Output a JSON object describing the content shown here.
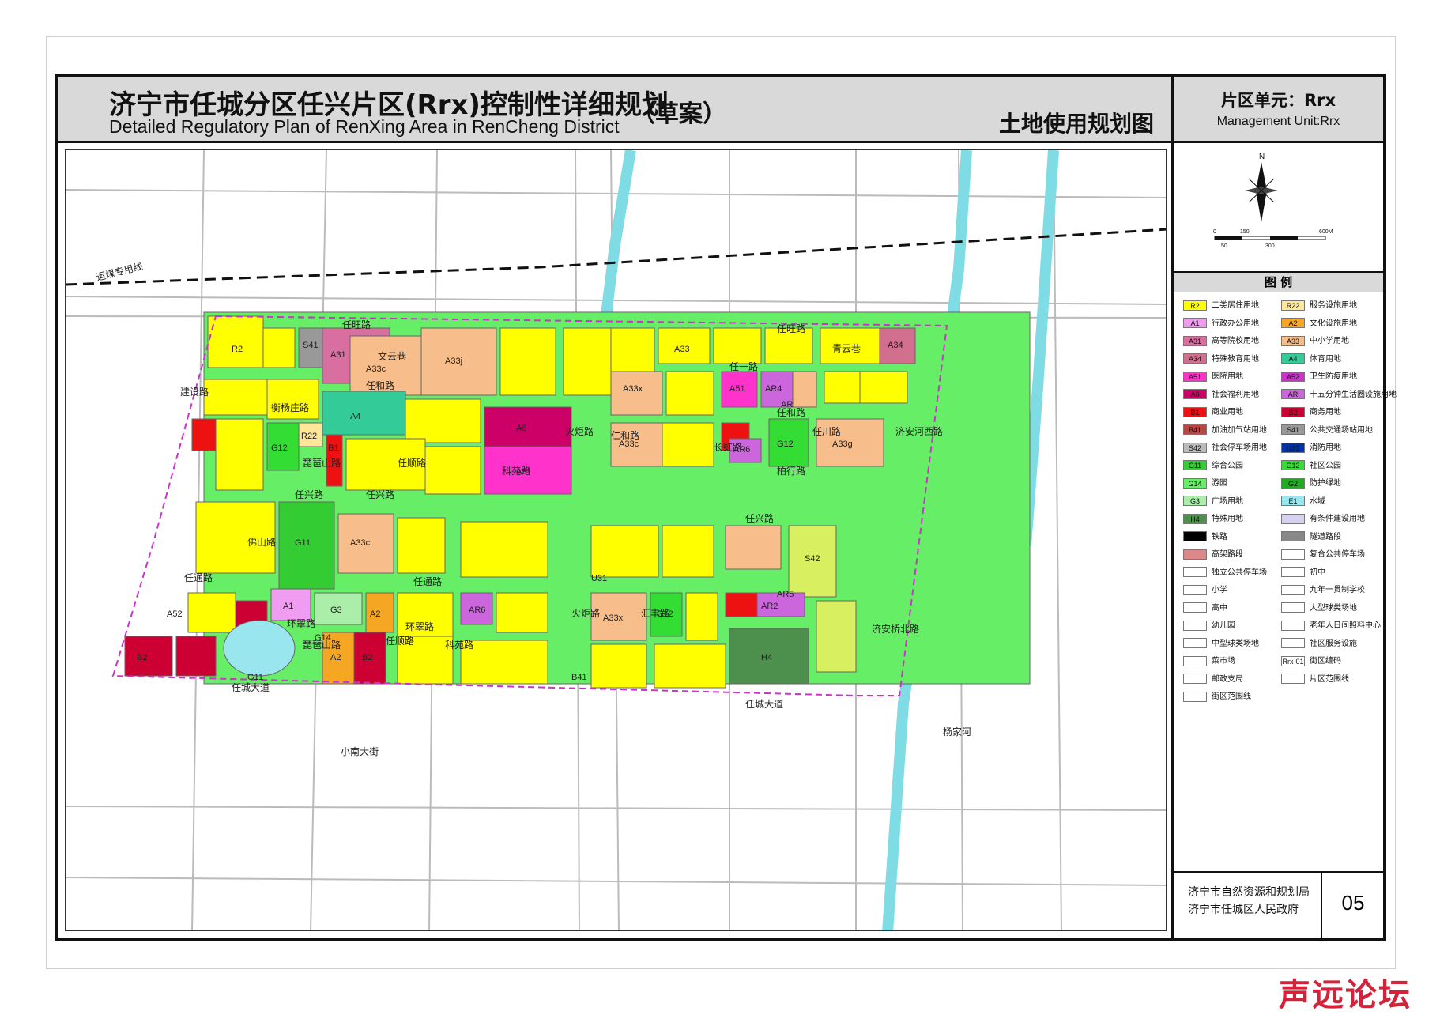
{
  "header": {
    "title_cn": "济宁市任城分区任兴片区(Rrx)控制性详细规划",
    "title_en": "Detailed Regulatory Plan of RenXing Area in RenCheng District",
    "draft": "（草案）",
    "map_name": "土地使用规划图"
  },
  "unit": {
    "cn": "片区单元：Rrx",
    "en": "Management Unit:Rrx"
  },
  "compass": {
    "north": "N",
    "scale_top": [
      "0",
      "150",
      "600M"
    ],
    "scale_bottom": [
      "50",
      "300"
    ]
  },
  "legend_title": "图  例",
  "legend": [
    {
      "code": "R2",
      "label": "二类居住用地",
      "color": "#ffff00"
    },
    {
      "code": "R22",
      "label": "服务设施用地",
      "color": "#ffe699"
    },
    {
      "code": "A1",
      "label": "行政办公用地",
      "color": "#f09cf0"
    },
    {
      "code": "A2",
      "label": "文化设施用地",
      "color": "#f5a623"
    },
    {
      "code": "A31",
      "label": "高等院校用地",
      "color": "#d86fa0"
    },
    {
      "code": "A33",
      "label": "中小学用地",
      "color": "#f7bd8a"
    },
    {
      "code": "A34",
      "label": "特殊教育用地",
      "color": "#d36f8e"
    },
    {
      "code": "A4",
      "label": "体育用地",
      "color": "#33cc99"
    },
    {
      "code": "A51",
      "label": "医院用地",
      "color": "#ff33cc"
    },
    {
      "code": "A52",
      "label": "卫生防疫用地",
      "color": "#cc33cc"
    },
    {
      "code": "A6",
      "label": "社会福利用地",
      "color": "#cc0066"
    },
    {
      "code": "AR",
      "label": "十五分钟生活圈设施用地",
      "color": "#cc66dd"
    },
    {
      "code": "B1",
      "label": "商业用地",
      "color": "#ee1111"
    },
    {
      "code": "B2",
      "label": "商务用地",
      "color": "#cc0033"
    },
    {
      "code": "B41",
      "label": "加油加气站用地",
      "color": "#bb4444"
    },
    {
      "code": "S41",
      "label": "公共交通场站用地",
      "color": "#999999"
    },
    {
      "code": "S42",
      "label": "社会停车场用地",
      "color": "#bbbbbb"
    },
    {
      "code": "U31",
      "label": "消防用地",
      "color": "#0033aa"
    },
    {
      "code": "G11",
      "label": "综合公园",
      "color": "#33cc33"
    },
    {
      "code": "G12",
      "label": "社区公园",
      "color": "#33dd33"
    },
    {
      "code": "G14",
      "label": "游园",
      "color": "#66ee66"
    },
    {
      "code": "G2",
      "label": "防护绿地",
      "color": "#22aa22"
    },
    {
      "code": "G3",
      "label": "广场用地",
      "color": "#aaeeaa"
    },
    {
      "code": "E1",
      "label": "水域",
      "color": "#99e6ee"
    },
    {
      "code": "H4",
      "label": "特殊用地",
      "color": "#4d8f4d"
    },
    {
      "code": "",
      "label": "有条件建设用地",
      "color": "#d8d0f0"
    },
    {
      "code": "",
      "label": "铁路",
      "color": "#000000"
    },
    {
      "code": "",
      "label": "隧道路段",
      "color": "#888888"
    },
    {
      "code": "",
      "label": "高架路段",
      "color": "#dd8888"
    },
    {
      "code": "",
      "label": "复合公共停车场",
      "color": "#ffffff"
    },
    {
      "code": "",
      "label": "独立公共停车场",
      "color": "#ffffff"
    },
    {
      "code": "",
      "label": "初中",
      "color": "#ffffff"
    },
    {
      "code": "",
      "label": "小学",
      "color": "#ffffff"
    },
    {
      "code": "",
      "label": "九年一贯制学校",
      "color": "#ffffff"
    },
    {
      "code": "",
      "label": "高中",
      "color": "#ffffff"
    },
    {
      "code": "",
      "label": "大型球类场地",
      "color": "#ffffff"
    },
    {
      "code": "",
      "label": "幼儿园",
      "color": "#ffffff"
    },
    {
      "code": "",
      "label": "老年人日间照料中心",
      "color": "#ffffff"
    },
    {
      "code": "",
      "label": "中型球类场地",
      "color": "#ffffff"
    },
    {
      "code": "",
      "label": "社区服务设施",
      "color": "#ffffff"
    },
    {
      "code": "",
      "label": "菜市场",
      "color": "#ffffff"
    },
    {
      "code": "Rrx-01",
      "label": "街区编码",
      "color": "#ffffff"
    },
    {
      "code": "",
      "label": "邮政支局",
      "color": "#ffffff"
    },
    {
      "code": "",
      "label": "片区范围线",
      "color": "#ffffff"
    },
    {
      "code": "",
      "label": "街区范围线",
      "color": "#ffffff"
    }
  ],
  "org": {
    "line1": "济宁市自然资源和规划局",
    "line2": "济宁市任城区人民政府",
    "page": "05"
  },
  "map": {
    "rail_label": "运煤专用线",
    "roads": [
      "任旺路",
      "任旺路",
      "任和路",
      "任一路",
      "任和路",
      "任兴路",
      "任兴路",
      "任兴路",
      "任通路",
      "任通路",
      "环翠路",
      "环翠路",
      "任城大道",
      "任城大道",
      "建设路",
      "琵琶山路",
      "琵琶山路",
      "任顺路",
      "任顺路",
      "科苑路",
      "科苑路",
      "火炬路",
      "火炬路",
      "仁和路",
      "汇丰路",
      "长虹路",
      "柏行路",
      "任川路",
      "济安河西路",
      "济安桥北路",
      "佛山路",
      "青云巷",
      "文云巷",
      "衡杨庄路",
      "小南大街",
      "杨家河"
    ],
    "parcels": [
      "R2",
      "R22",
      "A1",
      "A2",
      "A31",
      "A33",
      "A33c",
      "A33x",
      "A33j",
      "A33g",
      "A34",
      "A4",
      "A51",
      "A52",
      "A6",
      "AR",
      "AR2",
      "AR4",
      "AR5",
      "AR6",
      "B1",
      "B2",
      "B41",
      "S41",
      "S42",
      "U31",
      "G11",
      "G12",
      "G14",
      "G3",
      "H4"
    ]
  },
  "site_logo": "声远论坛"
}
